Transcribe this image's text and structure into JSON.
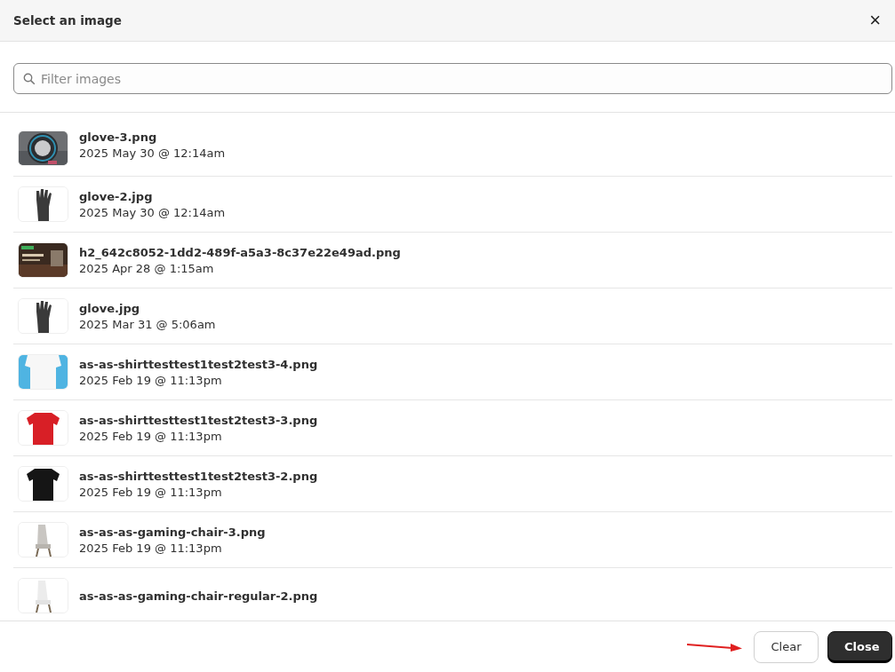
{
  "dialog": {
    "title": "Select an image",
    "close_glyph": "×"
  },
  "search": {
    "placeholder": "Filter images"
  },
  "images": [
    {
      "name": "glove-3.png",
      "date": "2025 May 30 @ 12:14am"
    },
    {
      "name": "glove-2.jpg",
      "date": "2025 May 30 @ 12:14am"
    },
    {
      "name": "h2_642c8052-1dd2-489f-a5a3-8c37e22e49ad.png",
      "date": "2025 Apr 28 @ 1:15am"
    },
    {
      "name": "glove.jpg",
      "date": "2025 Mar 31 @ 5:06am"
    },
    {
      "name": "as-as-shirttesttest1test2test3-4.png",
      "date": "2025 Feb 19 @ 11:13pm"
    },
    {
      "name": "as-as-shirttesttest1test2test3-3.png",
      "date": "2025 Feb 19 @ 11:13pm"
    },
    {
      "name": "as-as-shirttesttest1test2test3-2.png",
      "date": "2025 Feb 19 @ 11:13pm"
    },
    {
      "name": "as-as-as-gaming-chair-3.png",
      "date": "2025 Feb 19 @ 11:13pm"
    },
    {
      "name": "as-as-as-gaming-chair-regular-2.png"
    }
  ],
  "buttons": [
    {
      "label": "Clear",
      "kind": "secondary"
    },
    {
      "label": "Close",
      "kind": "primary"
    }
  ]
}
